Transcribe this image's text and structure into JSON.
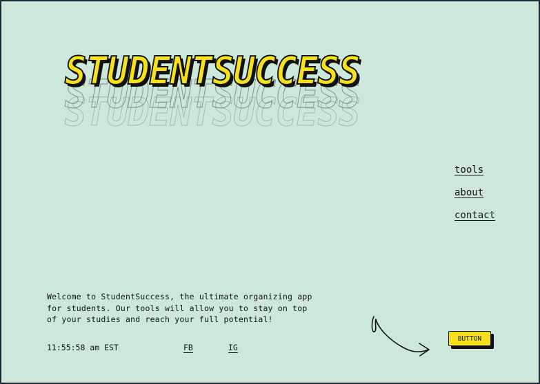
{
  "brand": {
    "title": "STUDENTSUCCESS"
  },
  "nav": {
    "items": [
      {
        "label": "tools"
      },
      {
        "label": "about"
      },
      {
        "label": "contact"
      }
    ]
  },
  "intro": {
    "text": "Welcome to StudentSuccess, the ultimate organizing app for students. Our tools will allow you to stay on top of your studies and reach your full potential!"
  },
  "footer": {
    "clock": "11:55:58 am EST",
    "fb_label": "FB",
    "ig_label": "IG"
  },
  "cta": {
    "label": "BUTTON"
  },
  "colors": {
    "background": "#cde8da",
    "accent": "#f7e11a",
    "ink": "#111111",
    "frame": "#1f2937"
  }
}
